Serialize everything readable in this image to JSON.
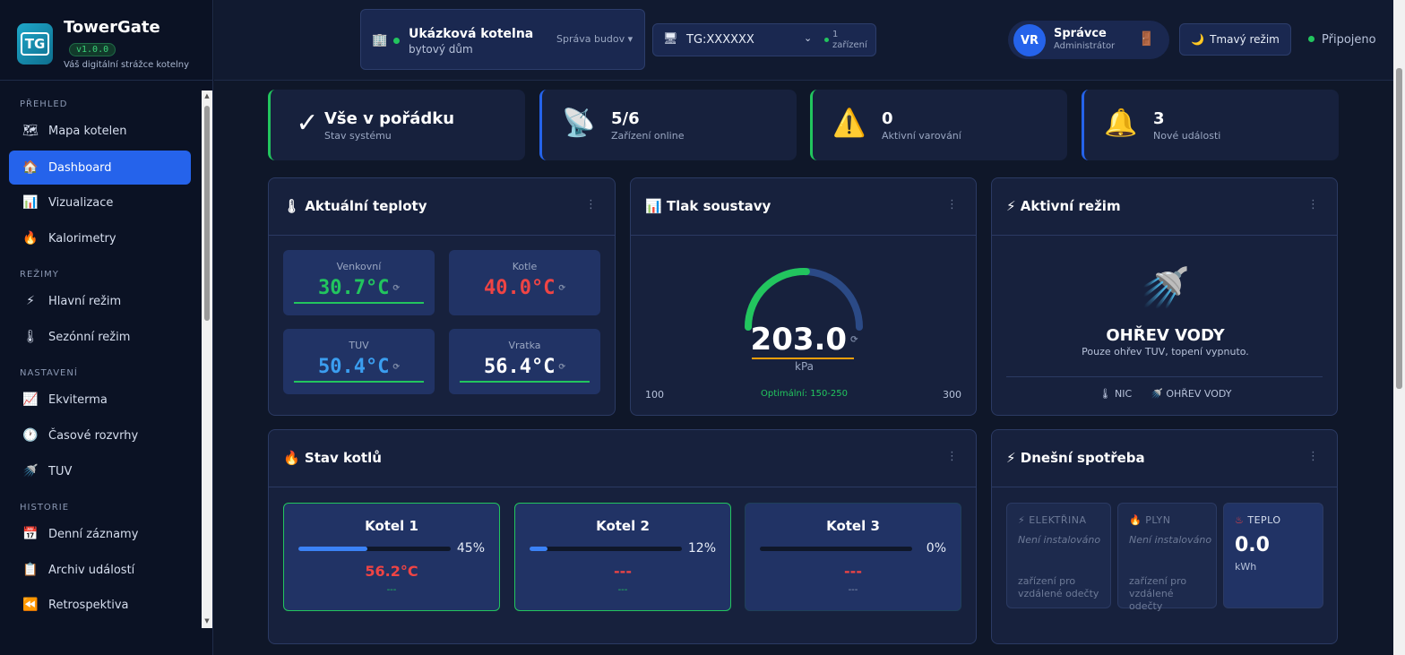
{
  "brand": {
    "name": "TowerGate",
    "version": "v1.0.0",
    "tagline": "Váš digitální strážce kotelny"
  },
  "page": {
    "cut_title": "... ...  ... ... ...... ..."
  },
  "nav": {
    "sections": {
      "overview": "PŘEHLED",
      "modes": "REŽIMY",
      "settings": "NASTAVENÍ",
      "history": "HISTORIE"
    },
    "items": [
      {
        "label": "Mapa kotelen",
        "icon": "🗺"
      },
      {
        "label": "Dashboard",
        "icon": "🏠"
      },
      {
        "label": "Vizualizace",
        "icon": "📊"
      },
      {
        "label": "Kalorimetry",
        "icon": "🔥"
      },
      {
        "label": "Hlavní režim",
        "icon": "⚡"
      },
      {
        "label": "Sezónní režim",
        "icon": "🌡"
      },
      {
        "label": "Ekviterma",
        "icon": "📈"
      },
      {
        "label": "Časové rozvrhy",
        "icon": "🕐"
      },
      {
        "label": "TUV",
        "icon": "🚿"
      },
      {
        "label": "Denní záznamy",
        "icon": "📅"
      },
      {
        "label": "Archiv událostí",
        "icon": "📋"
      },
      {
        "label": "Retrospektiva",
        "icon": "⏪"
      }
    ]
  },
  "topbar": {
    "building": {
      "name": "Ukázková kotelna",
      "type": "bytový dům",
      "manager": "Správa budov ▾"
    },
    "device": {
      "name": "TG:XXXXXX",
      "count_line1": "1",
      "count_line2": "zařízení"
    },
    "user": {
      "initials": "VR",
      "name": "Správce",
      "role": "Administrátor"
    },
    "dark_mode": "Tmavý režim",
    "status": "Připojeno"
  },
  "stats": [
    {
      "value": "Vše v pořádku",
      "label": "Stav systému",
      "icon": "✓"
    },
    {
      "value": "5/6",
      "label": "Zařízení online",
      "icon": "📡"
    },
    {
      "value": "0",
      "label": "Aktivní varování",
      "icon": "⚠️"
    },
    {
      "value": "3",
      "label": "Nové události",
      "icon": "🔔"
    }
  ],
  "temps": {
    "title": "Aktuální teploty",
    "items": [
      {
        "label": "Venkovní",
        "value": "30.7°C",
        "color": "#22c55e"
      },
      {
        "label": "Kotle",
        "value": "40.0°C",
        "color": "#ef4444"
      },
      {
        "label": "TUV",
        "value": "50.4°C",
        "color": "#3b9ef0"
      },
      {
        "label": "Vratka",
        "value": "56.4°C",
        "color": "#ffffff"
      }
    ]
  },
  "pressure": {
    "title": "Tlak soustavy",
    "value": "203.0",
    "unit": "kPa",
    "min": "100",
    "max": "300",
    "optimal": "Optimální: 150-250",
    "min_value": 100,
    "max_value": 300,
    "current": 203.0
  },
  "mode": {
    "title": "Aktivní režim",
    "name": "OHŘEV VODY",
    "desc": "Pouze ohřev TUV, topení vypnuto.",
    "season": "NIC",
    "tuv": "OHŘEV VODY"
  },
  "boilers": {
    "title": "Stav kotlů",
    "items": [
      {
        "name": "Kotel 1",
        "pct": "45%",
        "level": 0.45,
        "temp": "56.2°C",
        "state": "---"
      },
      {
        "name": "Kotel 2",
        "pct": "12%",
        "level": 0.12,
        "temp": "---",
        "state": "---"
      },
      {
        "name": "Kotel 3",
        "pct": "0%",
        "level": 0,
        "temp": "---",
        "state": "---"
      }
    ]
  },
  "consumption": {
    "title": "Dnešní spotřeba",
    "electric": {
      "label": "ELEKTŘINA",
      "status": "Není instalováno",
      "note": "zařízení pro vzdálené odečty"
    },
    "gas": {
      "label": "PLYN",
      "status": "Není instalováno",
      "note": "zařízení pro vzdálené odečty"
    },
    "heat": {
      "label": "TEPLO",
      "value": "0.0",
      "unit": "kWh"
    }
  }
}
